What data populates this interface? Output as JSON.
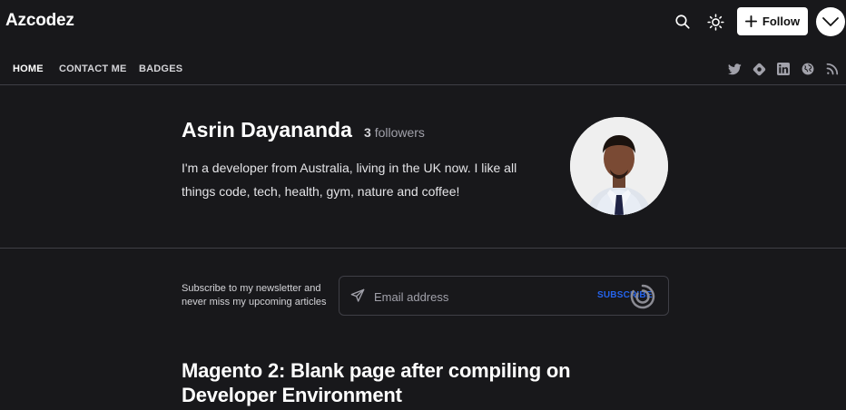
{
  "header": {
    "brand": "Azcodez",
    "follow_label": "Follow"
  },
  "nav": {
    "items": [
      {
        "label": "HOME",
        "active": true
      },
      {
        "label": "CONTACT ME",
        "active": false
      },
      {
        "label": "BADGES",
        "active": false
      }
    ],
    "social_icons": [
      "twitter-icon",
      "hashnode-icon",
      "linkedin-icon",
      "globe-icon",
      "rss-icon"
    ]
  },
  "profile": {
    "name": "Asrin Dayananda",
    "followers_count": "3",
    "followers_label": "followers",
    "bio": "I'm a developer from Australia, living in the UK now. I like all things code, tech, health, gym, nature and coffee!"
  },
  "newsletter": {
    "text": "Subscribe to my newsletter and never miss my upcoming articles",
    "email_placeholder": "Email address",
    "email_value": "",
    "subscribe_label": "SUBSCRIBE"
  },
  "article": {
    "title": "Magento 2: Blank page after compiling on Developer Environment"
  },
  "colors": {
    "background": "#18181b",
    "accent": "#2563eb",
    "divider": "#3f3f46"
  }
}
